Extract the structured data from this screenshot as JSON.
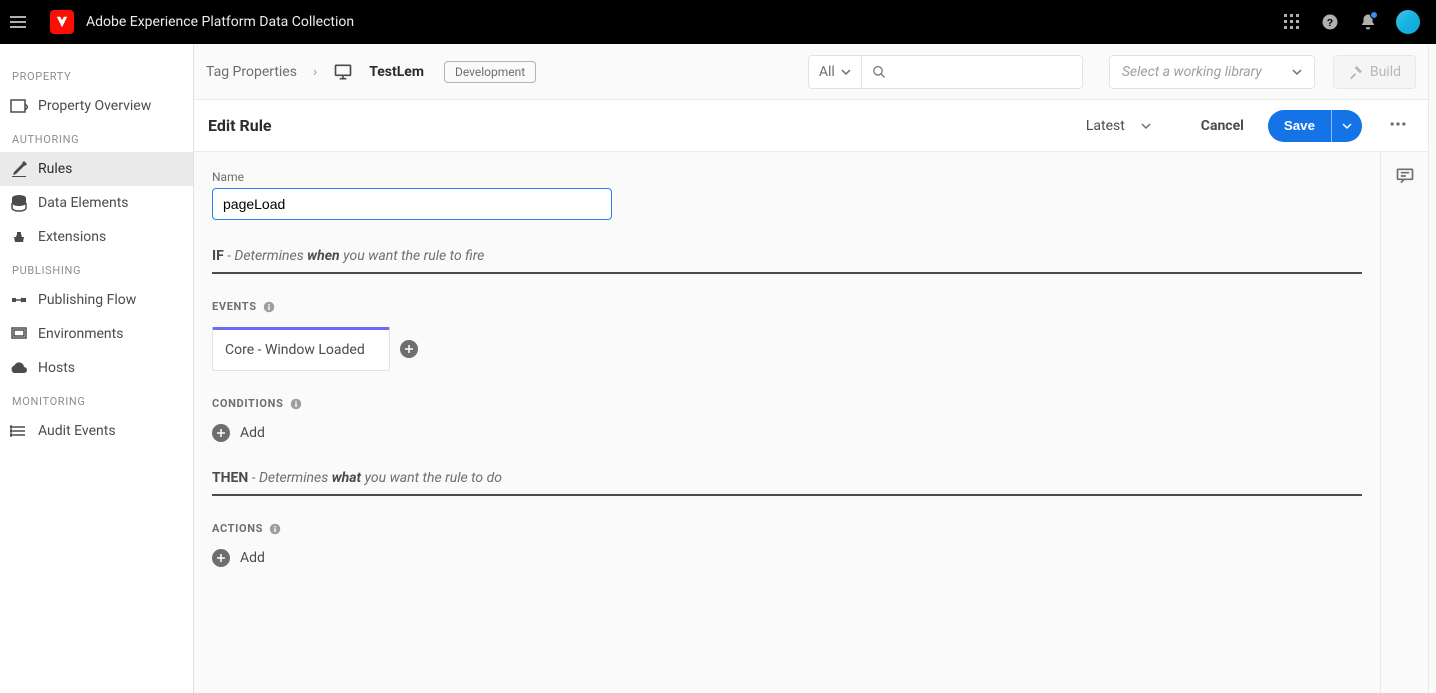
{
  "app": {
    "title": "Adobe Experience Platform Data Collection"
  },
  "sidebar": {
    "groups": [
      {
        "label": "PROPERTY",
        "items": [
          {
            "label": "Property Overview"
          }
        ]
      },
      {
        "label": "AUTHORING",
        "items": [
          {
            "label": "Rules"
          },
          {
            "label": "Data Elements"
          },
          {
            "label": "Extensions"
          }
        ]
      },
      {
        "label": "PUBLISHING",
        "items": [
          {
            "label": "Publishing Flow"
          },
          {
            "label": "Environments"
          },
          {
            "label": "Hosts"
          }
        ]
      },
      {
        "label": "MONITORING",
        "items": [
          {
            "label": "Audit Events"
          }
        ]
      }
    ]
  },
  "breadcrumb": {
    "root": "Tag Properties",
    "current": "TestLem",
    "badge": "Development"
  },
  "headerControls": {
    "filterMode": "All",
    "librarySelectPlaceholder": "Select a working library",
    "buildLabel": "Build"
  },
  "actionBar": {
    "title": "Edit Rule",
    "revision": "Latest",
    "cancel": "Cancel",
    "save": "Save"
  },
  "rule": {
    "nameLabel": "Name",
    "name": "pageLoad",
    "if": {
      "lead": "IF",
      "mid": "- Determines",
      "key": "when",
      "tail": "you want the rule to fire"
    },
    "then": {
      "lead": "THEN",
      "mid": "- Determines",
      "key": "what",
      "tail": "you want the rule to do"
    },
    "sections": {
      "events": {
        "heading": "EVENTS",
        "items": [
          {
            "label": "Core - Window Loaded"
          }
        ]
      },
      "conditions": {
        "heading": "CONDITIONS",
        "addLabel": "Add"
      },
      "actions": {
        "heading": "ACTIONS",
        "addLabel": "Add"
      }
    }
  }
}
